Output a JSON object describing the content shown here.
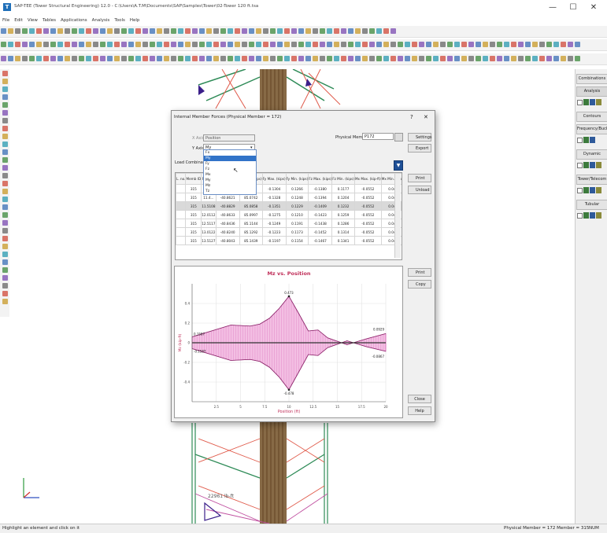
{
  "app": {
    "title": "SAP-TEE (Tower Structural Engineering) 12.0 - C:\\Users\\A.T.M\\Documents\\SAP\\Samples\\Tower\\02-Tower 120 ft.tsa",
    "logo": "T",
    "window_buttons": [
      "—",
      "☐",
      "✕"
    ]
  },
  "menu": [
    "File",
    "Edit",
    "View",
    "Tables",
    "Applications",
    "Analysis",
    "Tools",
    "Help"
  ],
  "right_panel": {
    "buttons": [
      "Combinations",
      "Analysis",
      "Contours",
      "Frequency/Buck...",
      "Dynamic",
      "Tower/Telecom",
      "Tubular"
    ]
  },
  "status": {
    "left": "Highlight an element and click on it",
    "center": "Physical Member = 172 Member = 315",
    "right": "NUM"
  },
  "canvas": {
    "label": "22961 lb-ft"
  },
  "dialog": {
    "title": "Internal Member Forces (Physical Member = 172)",
    "help": "?",
    "close": "✕",
    "x_axis_label": "X Axis",
    "x_axis_value": "Position",
    "y_axis_label": "Y Axis",
    "y_axis_value": "My",
    "load_combination_label": "Load Combination",
    "physical_member_label": "Physical Member",
    "physical_member_value": "P172",
    "buttons": {
      "settings": "Settings",
      "export": "Export",
      "print_table": "Print",
      "unload": "Unload",
      "print_chart": "Print",
      "copy": "Copy",
      "close": "Close",
      "help": "Help"
    },
    "dropdown_items": [
      "Fx",
      "My",
      "Fy",
      "Fz",
      "Mx",
      "My",
      "Mz",
      "Tz"
    ],
    "dropdown_selected_index": 1,
    "table": {
      "headers": [
        "L.\nno.",
        "Memb\nID",
        "Pos.\n(ft)",
        "Fx\nMax. (kips)",
        "Fx\nMin. (kips)",
        "Fy\nMax. (kips)",
        "Fy\nMin. (kips)",
        "Fz\nMax. (kips)",
        "Fz\nMin. (kips)",
        "Mx\nMax. (kip-ft)",
        "Mx\nMin. (kip-ft)",
        "My\nMax. (kip-ft)",
        "My\nMin. (kip-ft)"
      ],
      "rows": [
        [
          "",
          "315",
          "0.",
          "",
          "",
          "-0.1304",
          "0.1266",
          "-0.1380",
          "0.1177",
          "-0.0552",
          "0.0446",
          "-0.2703",
          ""
        ],
        [
          "",
          "315",
          "11.4...",
          "-40.8621",
          "85.0742",
          "-0.1328",
          "0.1248",
          "-0.1394",
          "0.1204",
          "-0.0552",
          "0.0446",
          "-0.2180",
          ""
        ],
        [
          "",
          "315",
          "11.5108",
          "-40.8829",
          "85.0858",
          "-0.1351",
          "0.1229",
          "-0.1409",
          "0.1232",
          "-0.0552",
          "0.0446",
          "-0.1624",
          ""
        ],
        [
          "",
          "315",
          "12.0112",
          "-40.8633",
          "85.0997",
          "-0.1275",
          "0.1210",
          "-0.1423",
          "0.1259",
          "-0.0552",
          "0.0446",
          "-0.1063",
          ""
        ],
        [
          "",
          "315",
          "12.5117",
          "-40.8436",
          "85.1144",
          "-0.1249",
          "0.1191",
          "-0.1438",
          "0.1286",
          "-0.0552",
          "0.0446",
          "-0.0704",
          ""
        ],
        [
          "",
          "315",
          "13.0122",
          "-40.8240",
          "85.1292",
          "-0.1223",
          "0.1173",
          "-0.1452",
          "0.1314",
          "-0.0552",
          "0.0446",
          "-0.1106",
          ""
        ],
        [
          "",
          "315",
          "13.5127",
          "-40.8043",
          "85.1439",
          "-0.1197",
          "0.1154",
          "-0.1467",
          "0.1341",
          "-0.0552",
          "0.0446",
          "-0.1548",
          ""
        ]
      ],
      "selected_row": 2
    },
    "chart_data": {
      "type": "area",
      "title": "Mz vs. Position",
      "xlabel": "Position (ft)",
      "ylabel": "Mz (kip-ft)",
      "xlim": [
        0,
        20
      ],
      "ylim": [
        -0.6,
        0.6
      ],
      "xticks": [
        "2.5",
        "5",
        "7.5",
        "10",
        "12.5",
        "15",
        "17.5",
        "20"
      ],
      "yticks": [
        "0.4",
        "0.2",
        "0",
        "-0.2",
        "-0.4"
      ],
      "grid": true,
      "annotations": [
        {
          "text": "0.473",
          "x": 10,
          "y": 0.473
        },
        {
          "text": "-0.478",
          "x": 10,
          "y": -0.478
        },
        {
          "text": "0.1587",
          "x": 0,
          "y": 0.06
        },
        {
          "text": "-0.1587",
          "x": 0,
          "y": -0.06
        },
        {
          "text": "0.0929",
          "x": 20,
          "y": 0.0929
        },
        {
          "text": "-0.0867",
          "x": 20,
          "y": -0.0867
        }
      ],
      "series": [
        {
          "color": "#d45fb3",
          "x": [
            0,
            2,
            4,
            6,
            7,
            8,
            9,
            10,
            11,
            12,
            13,
            14,
            16,
            18,
            20
          ],
          "upper": [
            0.06,
            0.12,
            0.18,
            0.17,
            0.19,
            0.25,
            0.35,
            0.473,
            0.3,
            0.12,
            0.13,
            0.05,
            -0.02,
            0.04,
            0.0929
          ],
          "lower": [
            -0.06,
            -0.12,
            -0.18,
            -0.17,
            -0.19,
            -0.25,
            -0.35,
            -0.478,
            -0.3,
            -0.12,
            -0.13,
            -0.05,
            0.02,
            -0.04,
            -0.0867
          ]
        }
      ]
    }
  }
}
